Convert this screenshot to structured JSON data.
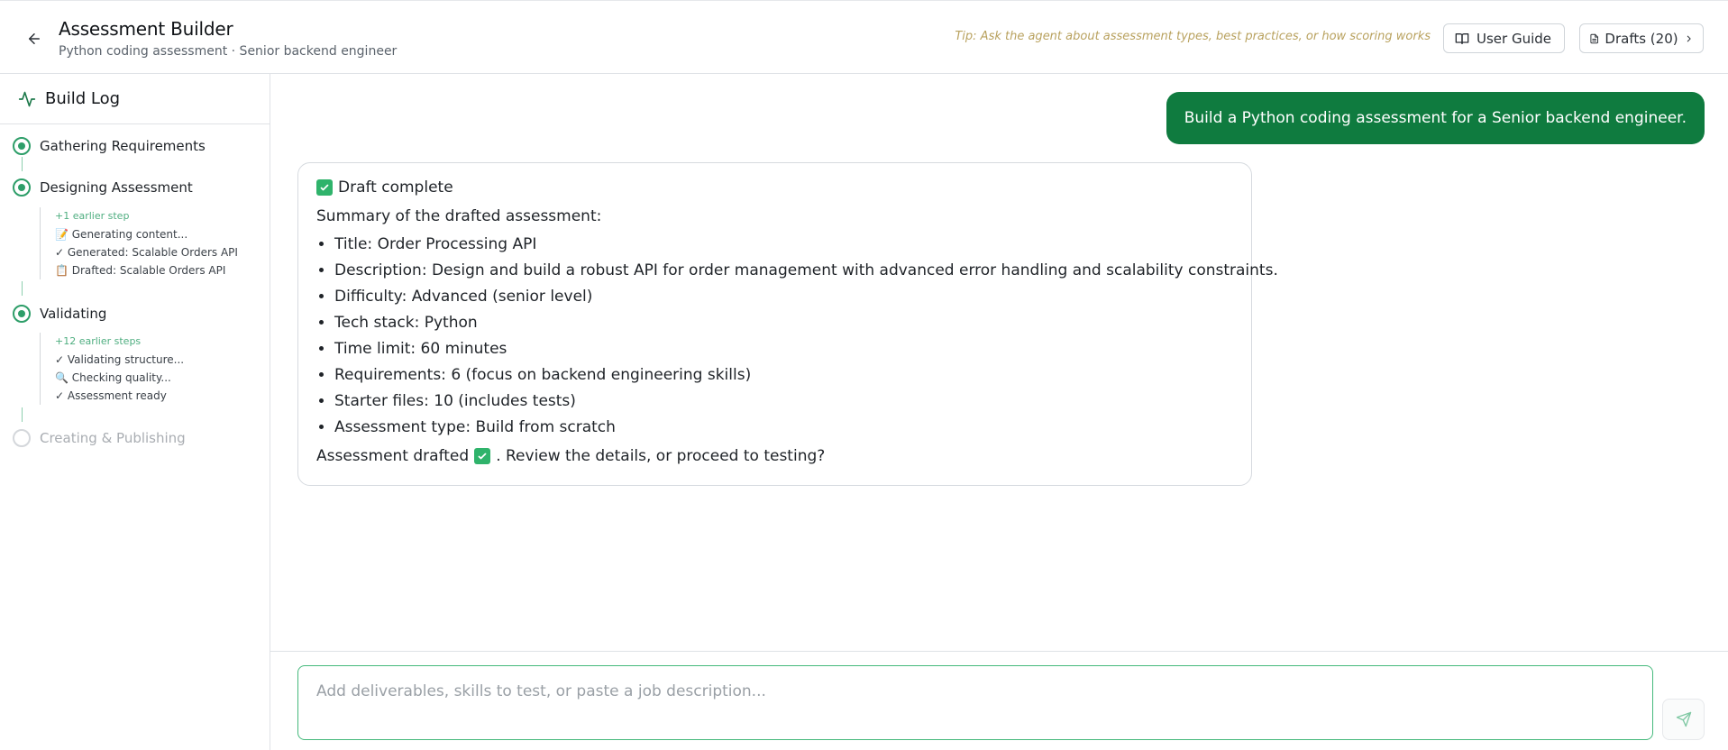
{
  "header": {
    "title": "Assessment Builder",
    "subtitle": "Python coding assessment · Senior backend engineer",
    "tip": "Tip: Ask the agent about assessment types, best practices, or how scoring works",
    "user_guide_label": "User Guide",
    "drafts_label": "Drafts (20)"
  },
  "sidebar": {
    "title": "Build Log",
    "stages": [
      {
        "label": "Gathering Requirements",
        "status": "done"
      },
      {
        "label": "Designing Assessment",
        "status": "done",
        "earlier": "+1 earlier step",
        "steps": [
          "📝 Generating content...",
          "✓ Generated: Scalable Orders API",
          "📋 Drafted: Scalable Orders API"
        ]
      },
      {
        "label": "Validating",
        "status": "done",
        "earlier": "+12 earlier steps",
        "steps": [
          "✓ Validating structure...",
          "🔍 Checking quality...",
          "✓ Assessment ready"
        ]
      },
      {
        "label": "Creating & Publishing",
        "status": "pending"
      }
    ]
  },
  "chat": {
    "user_message": "Build a Python coding assessment for a Senior backend engineer.",
    "agent": {
      "heading": "Draft complete",
      "intro": "Summary of the drafted assessment:",
      "items": [
        "Title: Order Processing API",
        "Description: Design and build a robust API for order management with advanced error handling and scalability constraints.",
        "Difficulty: Advanced (senior level)",
        "Tech stack: Python",
        "Time limit: 60 minutes",
        "Requirements: 6 (focus on backend engineering skills)",
        "Starter files: 10 (includes tests)",
        "Assessment type: Build from scratch"
      ],
      "footer_before": "Assessment drafted",
      "footer_after": ". Review the details, or proceed to testing?"
    }
  },
  "composer": {
    "placeholder": "Add deliverables, skills to test, or paste a job description...",
    "value": ""
  },
  "colors": {
    "accent": "#0f7b3f",
    "progress": "#2e9e69",
    "tip": "#b9a25f"
  }
}
